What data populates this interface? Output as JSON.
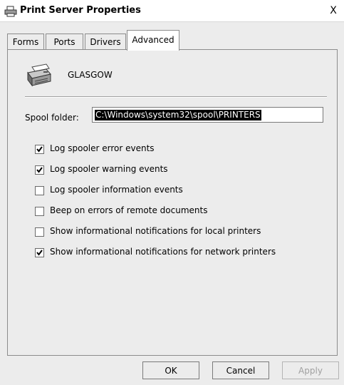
{
  "window": {
    "title": "Print Server Properties",
    "close_label": "X"
  },
  "tabs": [
    {
      "label": "Forms",
      "active": false
    },
    {
      "label": "Ports",
      "active": false
    },
    {
      "label": "Drivers",
      "active": false
    },
    {
      "label": "Advanced",
      "active": true
    }
  ],
  "advanced": {
    "server_name": "GLASGOW",
    "spool_label": "Spool folder:",
    "spool_value": "C:\\Windows\\system32\\spool\\PRINTERS",
    "options": [
      {
        "label": "Log spooler error events",
        "checked": true
      },
      {
        "label": "Log spooler warning events",
        "checked": true
      },
      {
        "label": "Log spooler information events",
        "checked": false
      },
      {
        "label": "Beep on errors of remote documents",
        "checked": false
      },
      {
        "label": "Show informational notifications for local printers",
        "checked": false
      },
      {
        "label": "Show informational notifications for network printers",
        "checked": true
      }
    ]
  },
  "buttons": {
    "ok": "OK",
    "cancel": "Cancel",
    "apply": "Apply",
    "apply_enabled": false
  }
}
